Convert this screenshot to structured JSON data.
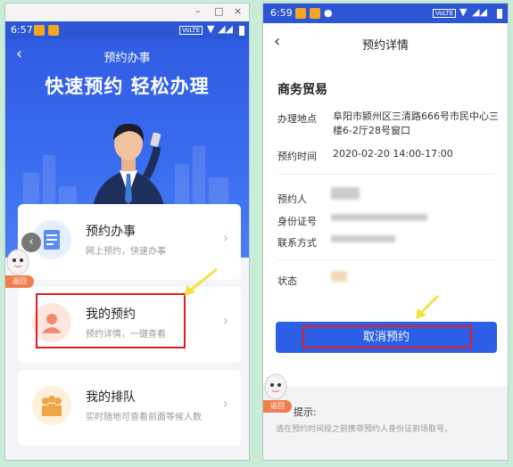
{
  "left": {
    "status_time": "6:57",
    "status_net": "VoLTE",
    "window_controls": [
      "–",
      "□",
      "×"
    ],
    "nav_back": "‹",
    "nav_title": "预约办事",
    "hero_title": "快速预约  轻松办理",
    "cards": [
      {
        "title": "预约办事",
        "subtitle": "网上预约，快速办事",
        "icon": "calendar-icon",
        "icon_bg": "#e6efff"
      },
      {
        "title": "我的预约",
        "subtitle": "预约详情，一键查看",
        "icon": "person-icon",
        "icon_bg": "#fde6de"
      },
      {
        "title": "我的排队",
        "subtitle": "实时随地可查看前面等候人数",
        "icon": "queue-icon",
        "icon_bg": "#fdf0dd"
      }
    ],
    "chevron": "›",
    "side_button": "‹",
    "return_label": "返回"
  },
  "right": {
    "status_time": "6:59",
    "status_net": "VoLTE",
    "nav_back": "‹",
    "nav_title": "预约详情",
    "section_title": "商务贸易",
    "location_label": "办理地点",
    "location_value": "阜阳市颍州区三清路666号市民中心三楼6-2厅28号窗口",
    "time_label": "预约时间",
    "time_value": "2020-02-20 14:00-17:00",
    "person_label": "预约人",
    "id_label": "身份证号",
    "contact_label": "联系方式",
    "status_label": "状态",
    "cancel_button": "取消预约",
    "tip_title": "提示:",
    "tip_text": "请在预约时间段之前携带预约人身份证到场取号。",
    "return_label": "返回"
  },
  "colors": {
    "primary": "#2d5fe6",
    "highlight_box": "#e02020",
    "arrow": "#f5e040"
  }
}
